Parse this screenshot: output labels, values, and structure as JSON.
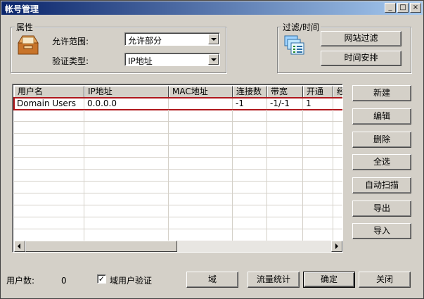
{
  "window": {
    "title": "帐号管理",
    "controls": [
      "_",
      "□",
      "×"
    ]
  },
  "properties": {
    "group_label": "属性",
    "scope_label": "允许范围:",
    "scope_value": "允许部分",
    "auth_label": "验证类型:",
    "auth_value": "IP地址"
  },
  "filter": {
    "group_label": "过滤/时间",
    "site_filter_button": "网站过滤",
    "schedule_button": "时间安排"
  },
  "table": {
    "columns": [
      "用户名",
      "IP地址",
      "MAC地址",
      "连接数",
      "带宽",
      "开通",
      "经"
    ],
    "rows": [
      [
        "Domain Users",
        "0.0.0.0",
        "",
        "-1",
        "-1/-1",
        "1",
        ""
      ]
    ]
  },
  "side_buttons": {
    "new": "新建",
    "edit": "编辑",
    "delete": "删除",
    "select_all": "全选",
    "auto_scan": "自动扫描",
    "export": "导出",
    "import": "导入"
  },
  "footer": {
    "user_count_label": "用户数:",
    "user_count_value": "0",
    "domain_auth_label": "域用户验证",
    "domain_auth_checked": "✓",
    "domain_button": "域",
    "traffic_button": "流量统计",
    "ok_button": "确定",
    "close_button": "关闭"
  }
}
